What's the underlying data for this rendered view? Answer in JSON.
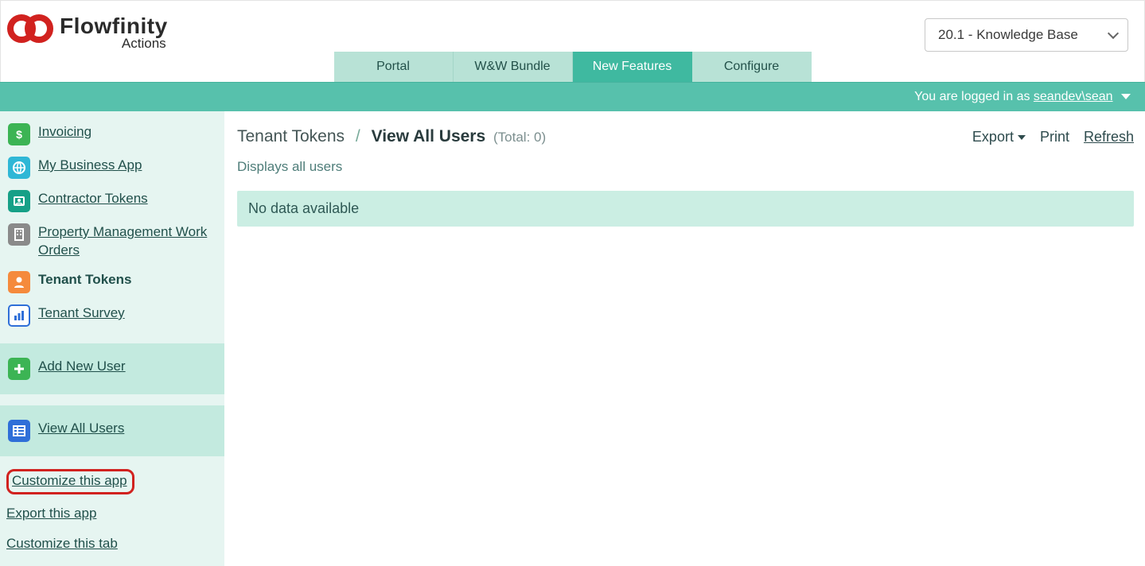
{
  "logo": {
    "name": "Flowfinity",
    "sub": "Actions"
  },
  "kb_selected": "20.1 - Knowledge Base",
  "tabs": [
    {
      "label": "Portal",
      "active": false
    },
    {
      "label": "W&W Bundle",
      "active": false
    },
    {
      "label": "New Features",
      "active": true
    },
    {
      "label": "Configure",
      "active": false
    }
  ],
  "login": {
    "prefix": "You are logged in as ",
    "user": "seandev\\sean"
  },
  "sidebar": {
    "apps": [
      {
        "label": "Invoicing",
        "icon": "dollar",
        "color": "#3cb454"
      },
      {
        "label": "My Business App",
        "icon": "globe",
        "color": "#2fb7d6"
      },
      {
        "label": "Contractor Tokens",
        "icon": "id",
        "color": "#16a087"
      },
      {
        "label": "Property Management Work Orders",
        "icon": "building",
        "color": "#8a8a8a"
      },
      {
        "label": "Tenant Tokens",
        "icon": "person",
        "color": "#f58a3c",
        "active": true
      },
      {
        "label": "Tenant Survey",
        "icon": "chart",
        "color": "#2f6fd8"
      }
    ],
    "add_user": "Add New User",
    "view_all": "View All Users",
    "customize_app": "Customize this app",
    "export_app": "Export this app",
    "customize_tab": "Customize this tab"
  },
  "breadcrumb": {
    "root": "Tenant Tokens",
    "current": "View All Users",
    "total_label": "(Total: 0)"
  },
  "page_actions": {
    "export": "Export",
    "print": "Print",
    "refresh": "Refresh"
  },
  "subtitle": "Displays all users",
  "empty_msg": "No data available"
}
